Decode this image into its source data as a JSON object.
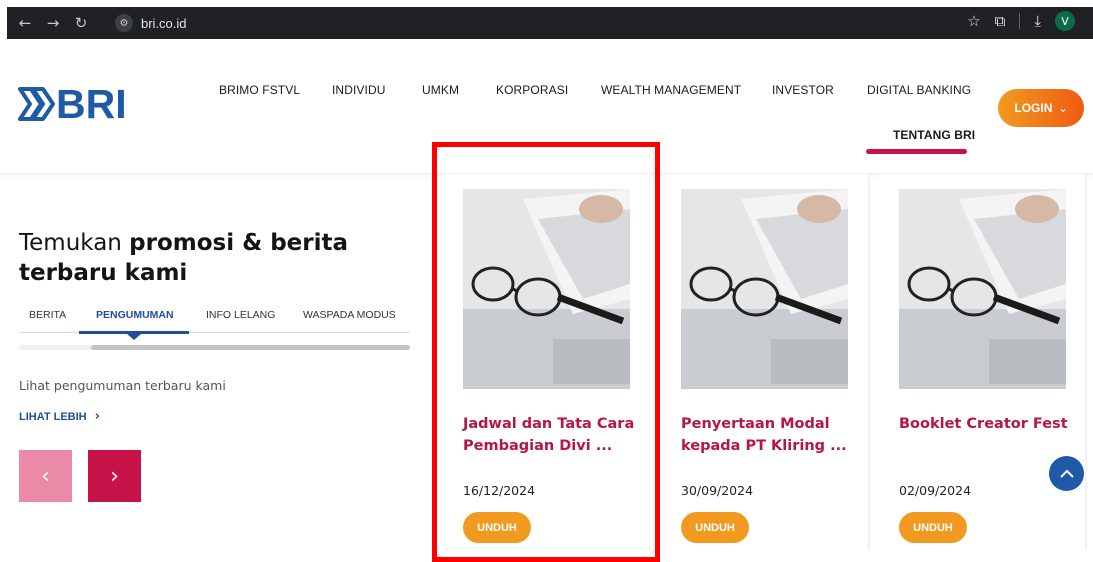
{
  "browser": {
    "url": "bri.co.id",
    "avatar_initial": "V",
    "icons": [
      "back-arrow-icon",
      "forward-arrow-icon",
      "reload-icon",
      "site-settings-icon",
      "star-icon",
      "extensions-icon",
      "download-icon"
    ]
  },
  "header": {
    "logo_text": "BRI",
    "nav": [
      "BRIMO FSTVL",
      "INDIVIDU",
      "UMKM",
      "KORPORASI",
      "WEALTH MANAGEMENT",
      "INVESTOR",
      "DIGITAL BANKING",
      "TENTANG BRI"
    ],
    "active_nav": "TENTANG BRI",
    "login_label": "LOGIN",
    "brand_blue": "#1f5aa6",
    "accent_red": "#c8134a",
    "accent_orange": "#f29a1f"
  },
  "promo": {
    "title_regular": "Temukan ",
    "title_bold1": "promosi & berita",
    "title_bold2": "terbaru kami",
    "tabs": [
      "BERITA",
      "PENGUMUMAN",
      "INFO LELANG",
      "WASPADA MODUS"
    ],
    "active_tab": "PENGUMUMAN",
    "subtitle": "Lihat pengumuman terbaru kami",
    "more_label": "LIHAT LEBIH"
  },
  "cards": [
    {
      "title": "Jadwal dan Tata Cara Pembagian Divi ...",
      "date": "16/12/2024",
      "button": "UNDUH"
    },
    {
      "title": "Penyertaan Modal kepada PT Kliring ...",
      "date": "30/09/2024",
      "button": "UNDUH"
    },
    {
      "title": "Booklet Creator Fest",
      "date": "02/09/2024",
      "button": "UNDUH"
    }
  ]
}
